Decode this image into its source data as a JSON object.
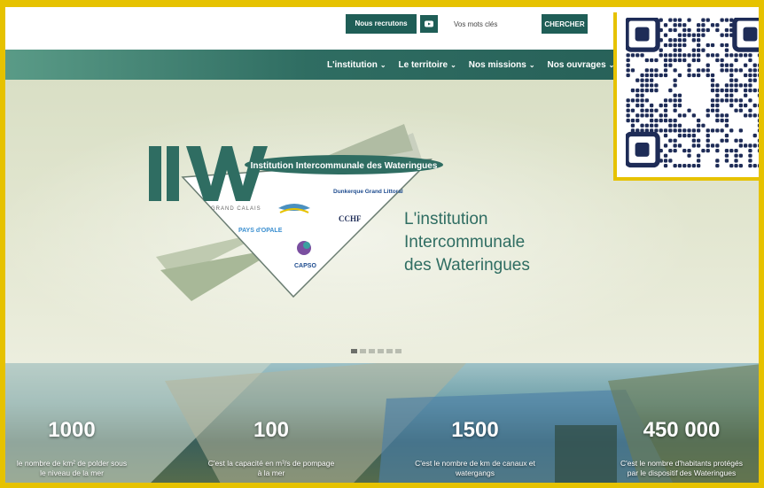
{
  "topbar": {
    "recruit_label": "Nous recrutons",
    "search_placeholder": "Vos mots clés",
    "search_button": "CHERCHER"
  },
  "nav": {
    "items": [
      {
        "label": "L'institution"
      },
      {
        "label": "Le territoire"
      },
      {
        "label": "Nos missions"
      },
      {
        "label": "Nos ouvrages"
      }
    ],
    "chevron": "⌄"
  },
  "hero": {
    "logo": {
      "letters": "IIW",
      "banner": "Institution Intercommunale des Wateringues",
      "partners": [
        "GRAND CALAIS",
        "PAYS d'OPALE",
        "Dunkerque Grand Littoral",
        "CCHF",
        "CAPSO"
      ]
    },
    "title_lines": [
      "L'institution",
      "Intercommunale",
      "des Wateringues"
    ],
    "slider_count": 6,
    "slider_active": 0
  },
  "stats": [
    {
      "number": "1000",
      "desc_lines": [
        "le nombre de km² de polder sous",
        "le niveau de la mer"
      ]
    },
    {
      "number": "100",
      "desc_lines": [
        "C'est la capacité en m³/s de pompage",
        "à la mer"
      ]
    },
    {
      "number": "1500",
      "desc_lines": [
        "C'est le nombre de km de canaux et",
        "watergangs"
      ]
    },
    {
      "number": "450 000",
      "desc_lines": [
        "C'est le nombre d'habitants protégés",
        "par le dispositif des Wateringues"
      ]
    }
  ],
  "colors": {
    "accent": "#1f5e57",
    "frame": "#e6c200",
    "qr": "#1e2c57"
  }
}
